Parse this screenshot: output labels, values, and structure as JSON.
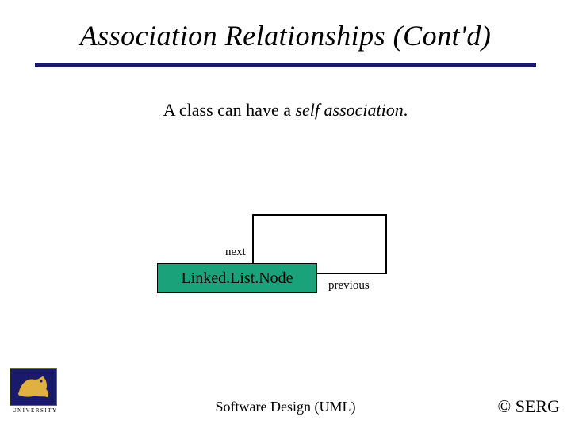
{
  "title": "Association Relationships (Cont'd)",
  "caption_prefix": "A class can have a ",
  "caption_em": "self association",
  "caption_suffix": ".",
  "diagram": {
    "class_name": "Linked.List.Node",
    "role_next": "next",
    "role_previous": "previous"
  },
  "logo": {
    "university": "UNIVERSITY",
    "icon": "dragon-icon"
  },
  "footer_center": "Software Design (UML)",
  "footer_right": "© SERG"
}
